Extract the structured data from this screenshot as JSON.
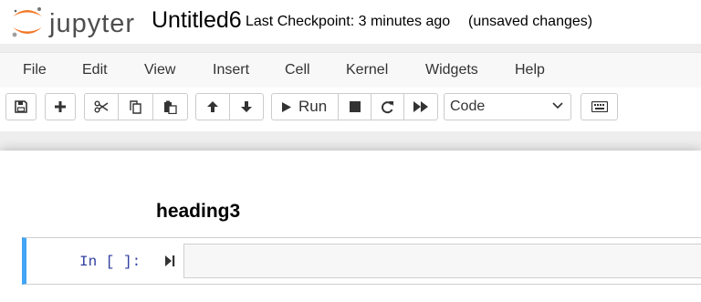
{
  "app": {
    "logo_text": "jupyter",
    "notebook_title": "Untitled6",
    "checkpoint": "Last Checkpoint: 3 minutes ago",
    "save_status": "(unsaved changes)"
  },
  "menubar": {
    "items": [
      "File",
      "Edit",
      "View",
      "Insert",
      "Cell",
      "Kernel",
      "Widgets",
      "Help"
    ]
  },
  "toolbar": {
    "buttons": [
      {
        "name": "save",
        "icon": "floppy-disk-icon"
      },
      {
        "name": "insert-cell",
        "icon": "plus-icon"
      },
      {
        "name": "cut",
        "icon": "scissors-icon"
      },
      {
        "name": "copy",
        "icon": "copy-icon"
      },
      {
        "name": "paste",
        "icon": "paste-icon"
      },
      {
        "name": "move-up",
        "icon": "arrow-up-icon"
      },
      {
        "name": "move-down",
        "icon": "arrow-down-icon"
      },
      {
        "name": "run",
        "icon": "play-icon"
      },
      {
        "name": "interrupt",
        "icon": "stop-icon"
      },
      {
        "name": "restart",
        "icon": "refresh-icon"
      },
      {
        "name": "restart-run-all",
        "icon": "fast-forward-icon"
      },
      {
        "name": "command-palette",
        "icon": "keyboard-icon"
      }
    ],
    "run_label": "Run",
    "cell_type": "Code"
  },
  "notebook": {
    "markdown_heading": "heading3",
    "code_prompt": "In [ ]:",
    "code_input": ""
  },
  "colors": {
    "logo_orange": "#f37726",
    "selected_cell_bar": "#42a5f5",
    "prompt_blue": "#303f9f"
  }
}
